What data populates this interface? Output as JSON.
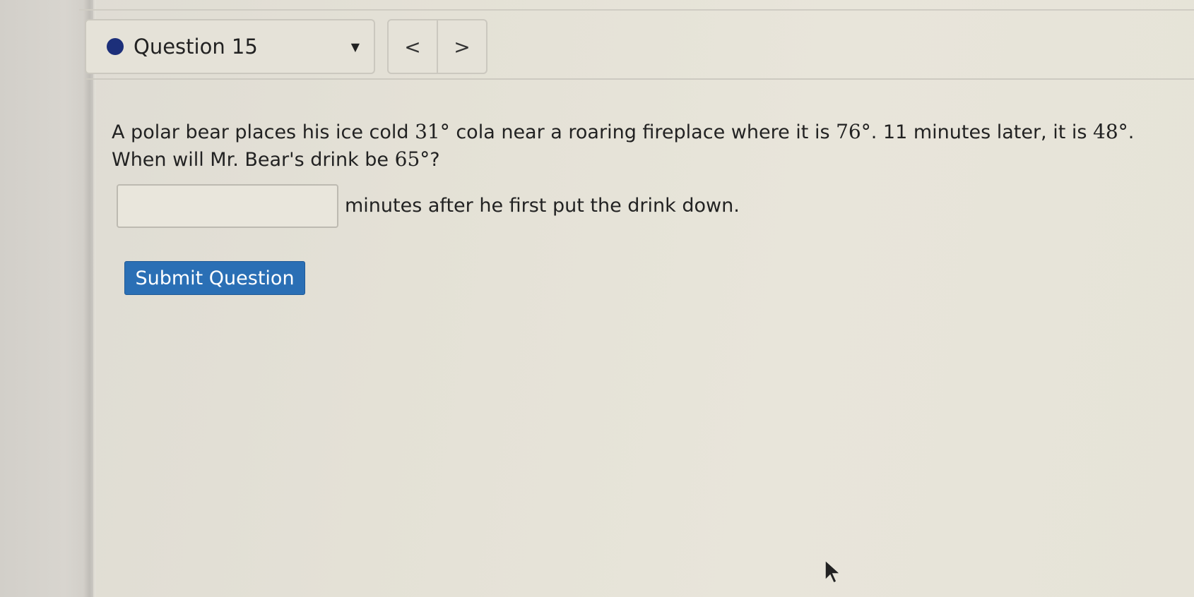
{
  "question_nav": {
    "label": "Question 15",
    "caret": "▼",
    "prev": "<",
    "next": ">",
    "status_color": "#1c2f7a"
  },
  "question": {
    "line1_a": "A polar bear places his ice cold ",
    "temp_start": "31°",
    "line1_b": " cola near a roaring fireplace where it is ",
    "temp_fire": "76°",
    "line1_c": ". 11 minutes later, it is ",
    "temp_later": "48°",
    "line1_d": ".",
    "line2_a": "When will Mr. Bear's drink be ",
    "temp_target": "65°",
    "line2_b": "?"
  },
  "answer": {
    "value": "",
    "suffix": "minutes after he first put the drink down."
  },
  "submit": {
    "label": "Submit Question",
    "color": "#2a6fb5"
  }
}
